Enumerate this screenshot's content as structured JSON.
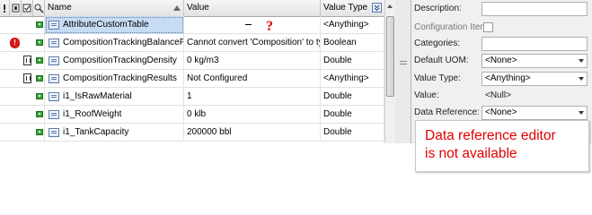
{
  "grid": {
    "columns": [
      {
        "name": "Name"
      },
      {
        "name": "Value"
      },
      {
        "name": "Value Type"
      }
    ],
    "rows": [
      {
        "name": "AttributeCustomTable",
        "value": "",
        "value_type": "<Anything>",
        "selected": true,
        "status": ""
      },
      {
        "name": "CompositionTrackingBalanceFlag",
        "value": "Cannot convert 'Composition' to type...",
        "value_type": "Boolean",
        "selected": false,
        "status": "error"
      },
      {
        "name": "CompositionTrackingDensity",
        "value": "0 kg/m3",
        "value_type": "Double",
        "selected": false,
        "status": "box"
      },
      {
        "name": "CompositionTrackingResults",
        "value": "Not Configured",
        "value_type": "<Anything>",
        "selected": false,
        "status": "box"
      },
      {
        "name": "i1_IsRawMaterial",
        "value": "1",
        "value_type": "Double",
        "selected": false,
        "status": ""
      },
      {
        "name": "i1_RoofWeight",
        "value": "0 klb",
        "value_type": "Double",
        "selected": false,
        "status": ""
      },
      {
        "name": "i1_TankCapacity",
        "value": "200000 bbl",
        "value_type": "Double",
        "selected": false,
        "status": ""
      }
    ],
    "error_indicator": "!",
    "question_mark": "?"
  },
  "properties": {
    "description_label": "Description:",
    "configuration_item_label": "Configuration Item:",
    "categories_label": "Categories:",
    "default_uom_label": "Default UOM:",
    "default_uom_value": "<None>",
    "value_type_label": "Value Type:",
    "value_type_value": "<Anything>",
    "value_label": "Value:",
    "value_value": "<Null>",
    "data_reference_label": "Data Reference:",
    "data_reference_value": "<None>"
  },
  "annotation": {
    "line1": "Data reference editor",
    "line2": "is not available"
  },
  "colors": {
    "annotation_text": "#e00000",
    "selection": "#c6dcf4",
    "error": "#d01a1a",
    "status_green": "#3aa63a"
  }
}
